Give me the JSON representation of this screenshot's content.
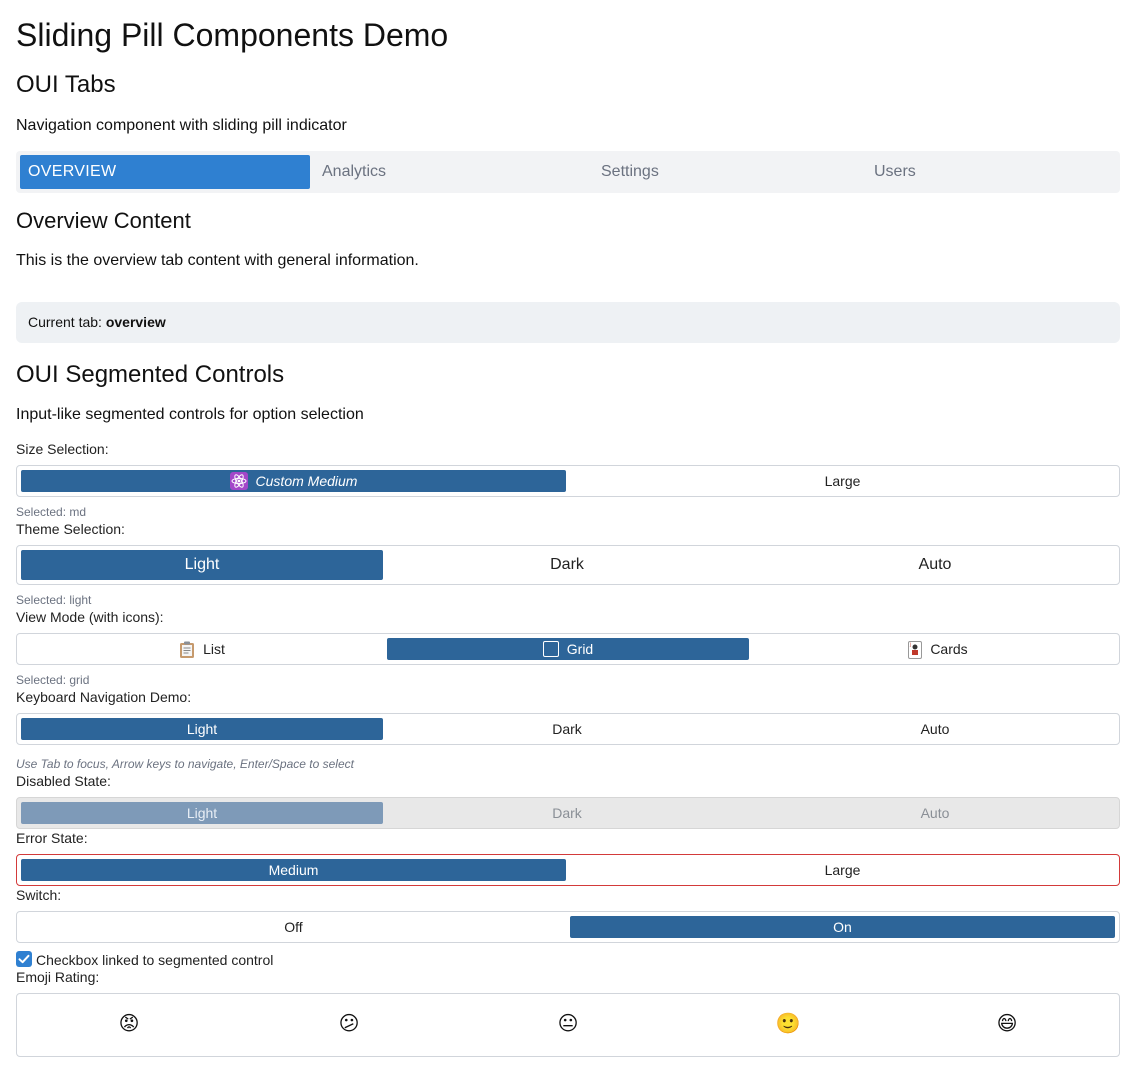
{
  "page": {
    "title": "Sliding Pill Components Demo"
  },
  "tabs_section": {
    "heading": "OUI Tabs",
    "description": "Navigation component with sliding pill indicator",
    "tabs": [
      "OVERVIEW",
      "Analytics",
      "Settings",
      "Users"
    ],
    "active_index": 0,
    "content_heading": "Overview Content",
    "content_text": "This is the overview tab content with general information.",
    "status_label": "Current tab: ",
    "status_value": "overview"
  },
  "segmented_section": {
    "heading": "OUI Segmented Controls",
    "description": "Input-like segmented controls for option selection",
    "size": {
      "label": "Size Selection:",
      "options": [
        "Custom Medium",
        "Large"
      ],
      "icon_first": "atom-icon",
      "selected_index": 0,
      "hint": "Selected: md"
    },
    "theme": {
      "label": "Theme Selection:",
      "options": [
        "Light",
        "Dark",
        "Auto"
      ],
      "selected_index": 0,
      "hint": "Selected: light"
    },
    "view_mode": {
      "label": "View Mode (with icons):",
      "options": [
        "List",
        "Grid",
        "Cards"
      ],
      "icons": [
        "clipboard-icon",
        "square-icon",
        "playing-card-icon"
      ],
      "selected_index": 1,
      "hint": "Selected: grid"
    },
    "keyboard": {
      "label": "Keyboard Navigation Demo:",
      "options": [
        "Light",
        "Dark",
        "Auto"
      ],
      "selected_index": 0,
      "hint": "Use Tab to focus, Arrow keys to navigate, Enter/Space to select"
    },
    "disabled": {
      "label": "Disabled State:",
      "options": [
        "Light",
        "Dark",
        "Auto"
      ],
      "selected_index": 0
    },
    "error": {
      "label": "Error State:",
      "options": [
        "Medium",
        "Large"
      ],
      "selected_index": 0
    },
    "switch": {
      "label": "Switch:",
      "options": [
        "Off",
        "On"
      ],
      "selected_index": 1
    },
    "checkbox": {
      "label": "Checkbox linked to segmented control",
      "checked": true
    },
    "emoji_rating": {
      "label": "Emoji Rating:",
      "options": [
        "😡",
        "😕",
        "😐",
        "🙂",
        "😄"
      ]
    }
  },
  "colors": {
    "tab_active": "#2f80d1",
    "segment_selected": "#2d6599",
    "error_border": "#d33a3a",
    "disabled_selected": "#7e9ab8"
  }
}
